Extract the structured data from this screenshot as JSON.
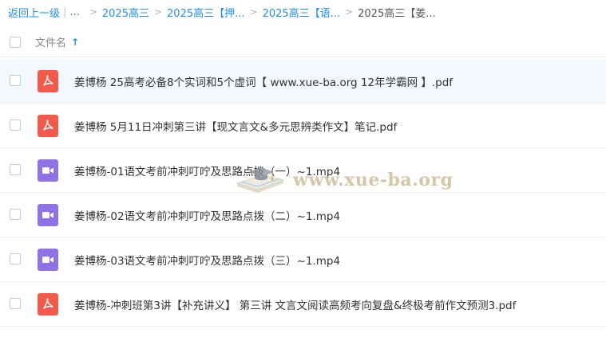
{
  "breadcrumb": {
    "back": "返回上一级",
    "ellipsis": "...",
    "items": [
      "2025高三",
      "2025高三【押...",
      "2025高三【语..."
    ],
    "current": "2025高三【姜..."
  },
  "header": {
    "column_title": "文件名",
    "sort_icon": "↑"
  },
  "files": [
    {
      "icon": "pdf-icon",
      "name": "姜博杨 25高考必备8个实词和5个虚词【 www.xue-ba.org 12年学霸网 】.pdf",
      "highlighted": true
    },
    {
      "icon": "pdf-icon",
      "name": "姜博杨 5月11日冲刺第三讲【现文言文&多元思辨类作文】笔记.pdf",
      "highlighted": false
    },
    {
      "icon": "video-icon",
      "name": "姜博杨-01语文考前冲刺叮咛及思路点拨（一）~1.mp4",
      "highlighted": false
    },
    {
      "icon": "video-icon",
      "name": "姜博杨-02语文考前冲刺叮咛及思路点拨（二）~1.mp4",
      "highlighted": false
    },
    {
      "icon": "video-icon",
      "name": "姜博杨-03语文考前冲刺叮咛及思路点拨（三）~1.mp4",
      "highlighted": false
    },
    {
      "icon": "pdf-icon",
      "name": "姜博杨-冲刺班第3讲【补充讲义】 第三讲 文言文阅读高频考向复盘&终极考前作文预测3.pdf",
      "highlighted": false
    }
  ],
  "watermark": {
    "text": "www.xue-ba.org",
    "icon": "graduation-book-icon"
  },
  "colors": {
    "link": "#1f8ff0",
    "pdf": "#f25a4c",
    "video": "#8f73e6",
    "row_highlight": "#f2f8fd"
  }
}
